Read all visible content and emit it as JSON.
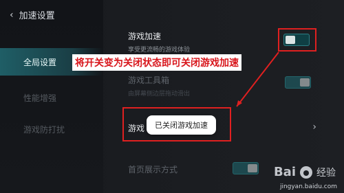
{
  "header": {
    "back_label": "加速设置"
  },
  "sidebar": {
    "items": [
      {
        "label": "全局设置"
      },
      {
        "label": "性能增强"
      },
      {
        "label": "游戏防打扰"
      }
    ]
  },
  "settings": {
    "game_accel": {
      "title": "游戏加速",
      "desc": "享受更流畅的游戏体验"
    },
    "game_toolbox": {
      "title": "游戏工具箱",
      "desc": "由屏幕侧边层拖动滑出"
    },
    "game_item_partial": {
      "title": "游戏"
    },
    "home_display": {
      "title": "首页展示方式"
    }
  },
  "annotation": {
    "text": "将开关变为关闭状态即可关闭游戏加速"
  },
  "toast": {
    "text": "已关闭游戏加速"
  },
  "watermark": {
    "brand": "Bai",
    "brand_suffix": "经验",
    "url": "jingyan.baidu.com"
  },
  "colors": {
    "accent": "#2aa1a8",
    "annotation": "#e02020"
  }
}
